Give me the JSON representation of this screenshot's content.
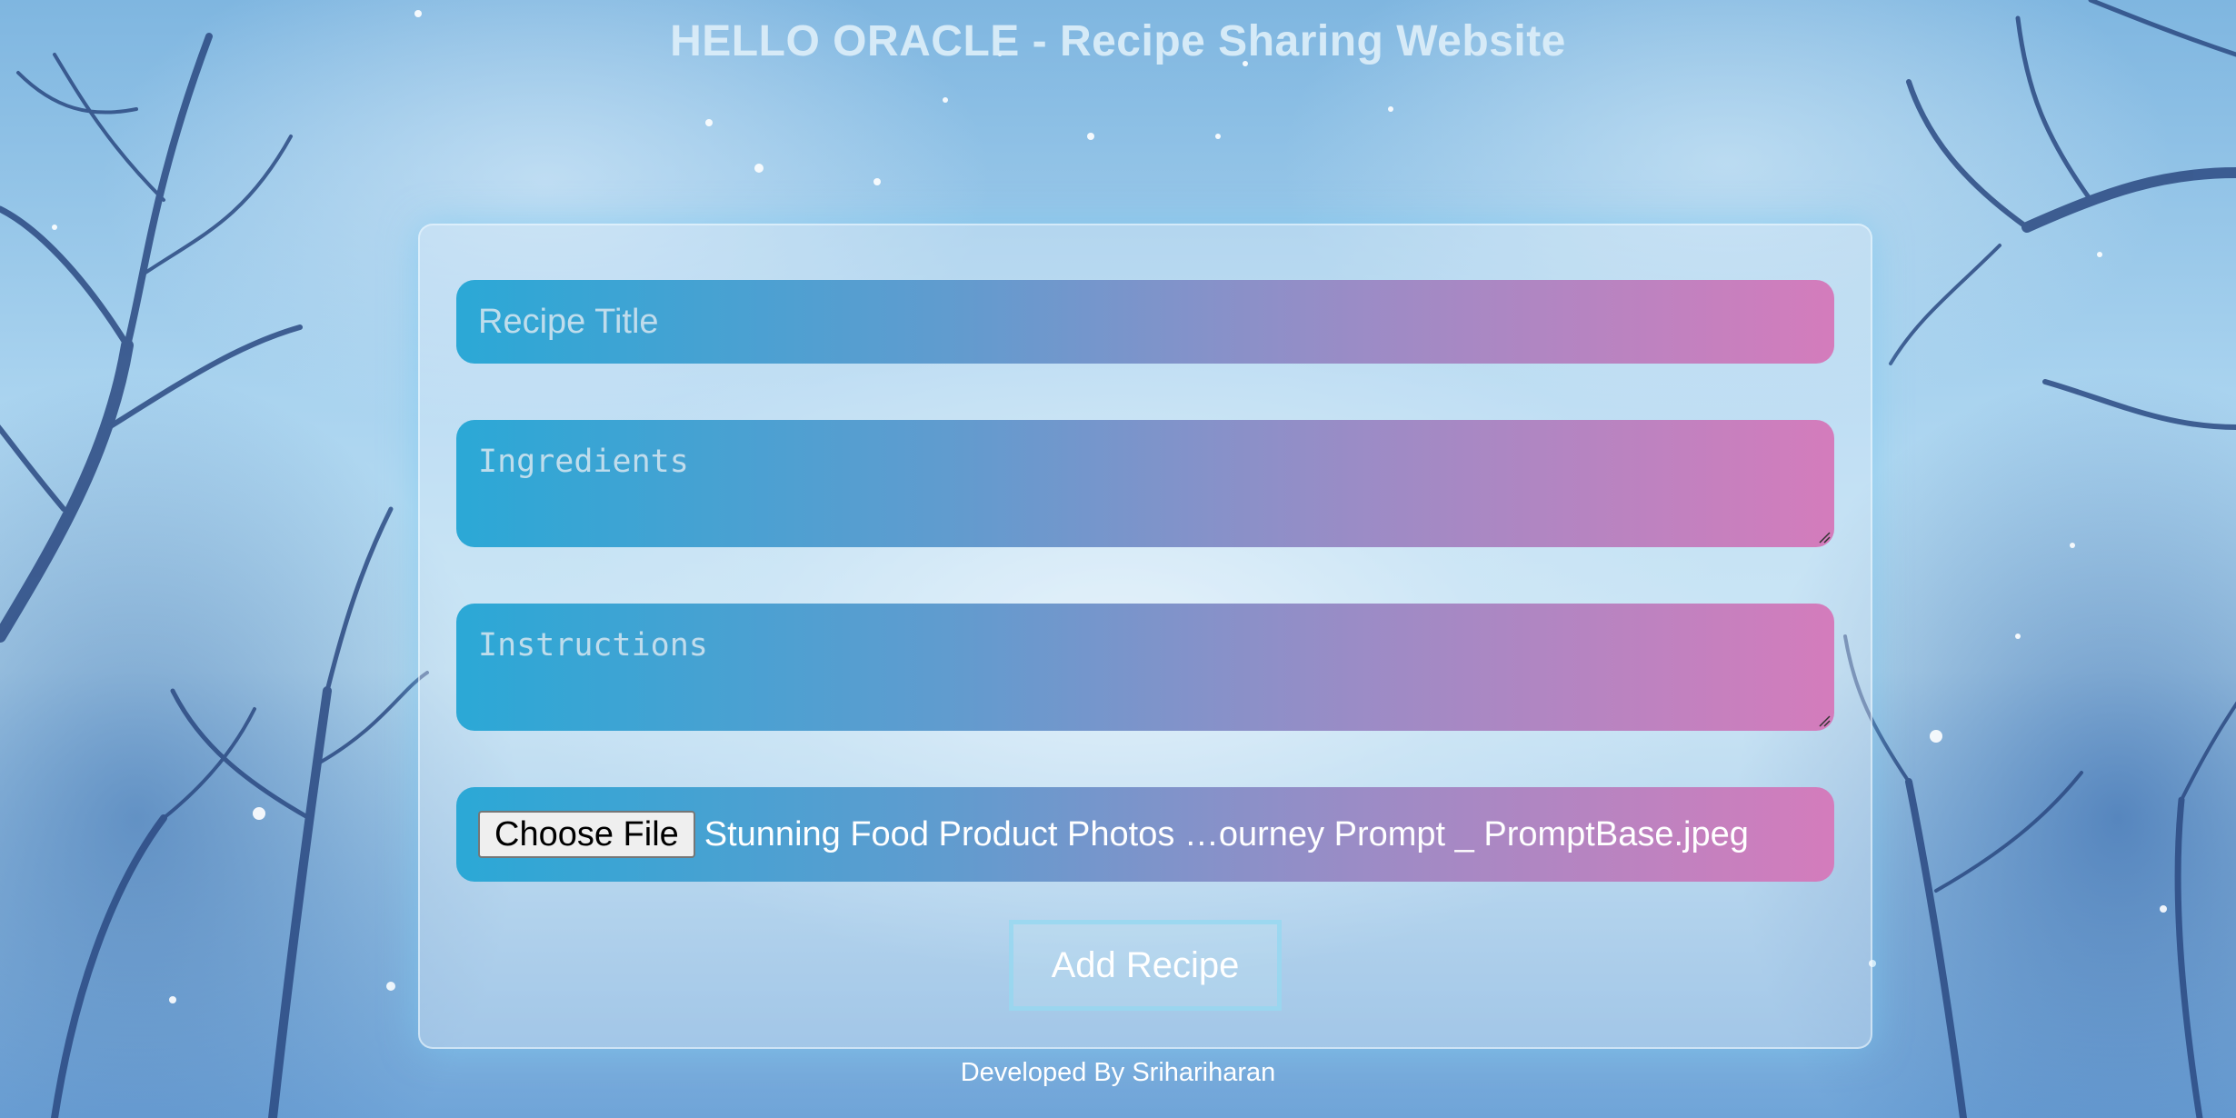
{
  "header": {
    "title": "HELLO ORACLE - Recipe Sharing Website"
  },
  "form": {
    "recipe_title_placeholder": "Recipe Title",
    "ingredients_placeholder": "Ingredients",
    "instructions_placeholder": "Instructions",
    "file_button_label": "Choose File",
    "file_name": "Stunning Food Product Photos …ourney Prompt _ PromptBase.jpeg",
    "submit_label": "Add Recipe"
  },
  "footer": {
    "text": "Developed By Srihariharan"
  },
  "colors": {
    "field_gradient_start": "#2ba8d6",
    "field_gradient_end": "#d47cbc",
    "title_color": "#dceef8",
    "accent_border": "#96d7f0"
  }
}
